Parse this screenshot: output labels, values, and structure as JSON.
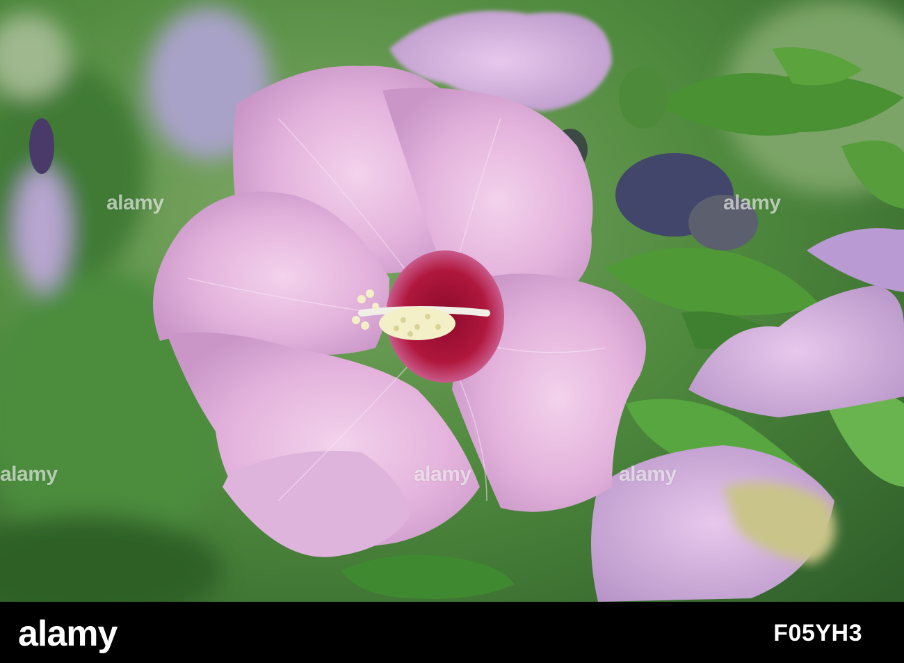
{
  "watermark_text": "alamy",
  "footer": {
    "logo_text": "alamy",
    "image_id_text": "F05YH3"
  }
}
